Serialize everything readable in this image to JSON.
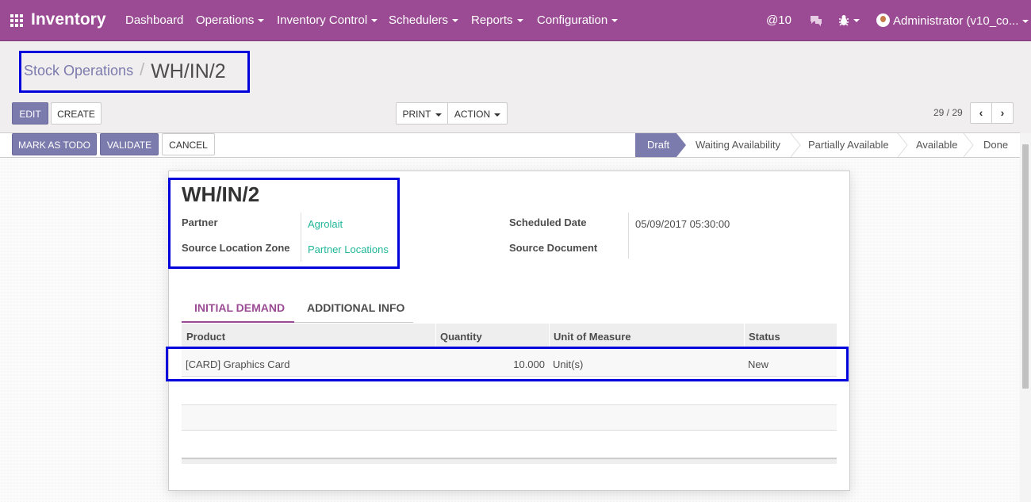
{
  "nav": {
    "app_title": "Inventory",
    "menus": [
      "Dashboard",
      "Operations",
      "Inventory Control",
      "Schedulers",
      "Reports",
      "Configuration"
    ],
    "mentions": "@10",
    "user": "Administrator (v10_co..."
  },
  "breadcrumb": {
    "parent": "Stock Operations",
    "separator": "/",
    "current": "WH/IN/2"
  },
  "buttons": {
    "edit": "EDIT",
    "create": "CREATE",
    "print": "PRINT",
    "action": "ACTION",
    "mark_as_todo": "MARK AS TODO",
    "validate": "VALIDATE",
    "cancel": "CANCEL"
  },
  "pager": {
    "value": "29 / 29",
    "prev": "‹",
    "next": "›"
  },
  "stages": [
    "Draft",
    "Waiting Availability",
    "Partially Available",
    "Available",
    "Done"
  ],
  "active_stage": "Draft",
  "record": {
    "name": "WH/IN/2",
    "partner_label": "Partner",
    "partner": "Agrolait",
    "source_zone_label": "Source Location Zone",
    "source_zone": "Partner Locations",
    "scheduled_date_label": "Scheduled Date",
    "scheduled_date": "05/09/2017 05:30:00",
    "source_document_label": "Source Document",
    "source_document": ""
  },
  "tabs": [
    "INITIAL DEMAND",
    "ADDITIONAL INFO"
  ],
  "table": {
    "headers": [
      "Product",
      "Quantity",
      "Unit of Measure",
      "Status"
    ],
    "rows": [
      {
        "product": "[CARD] Graphics Card",
        "quantity": "10.000",
        "uom": "Unit(s)",
        "status": "New"
      }
    ]
  },
  "colors": {
    "brand": "#9a4b93",
    "primary_button": "#7c7bad",
    "link": "#21b799",
    "highlight": "#0000dd"
  }
}
